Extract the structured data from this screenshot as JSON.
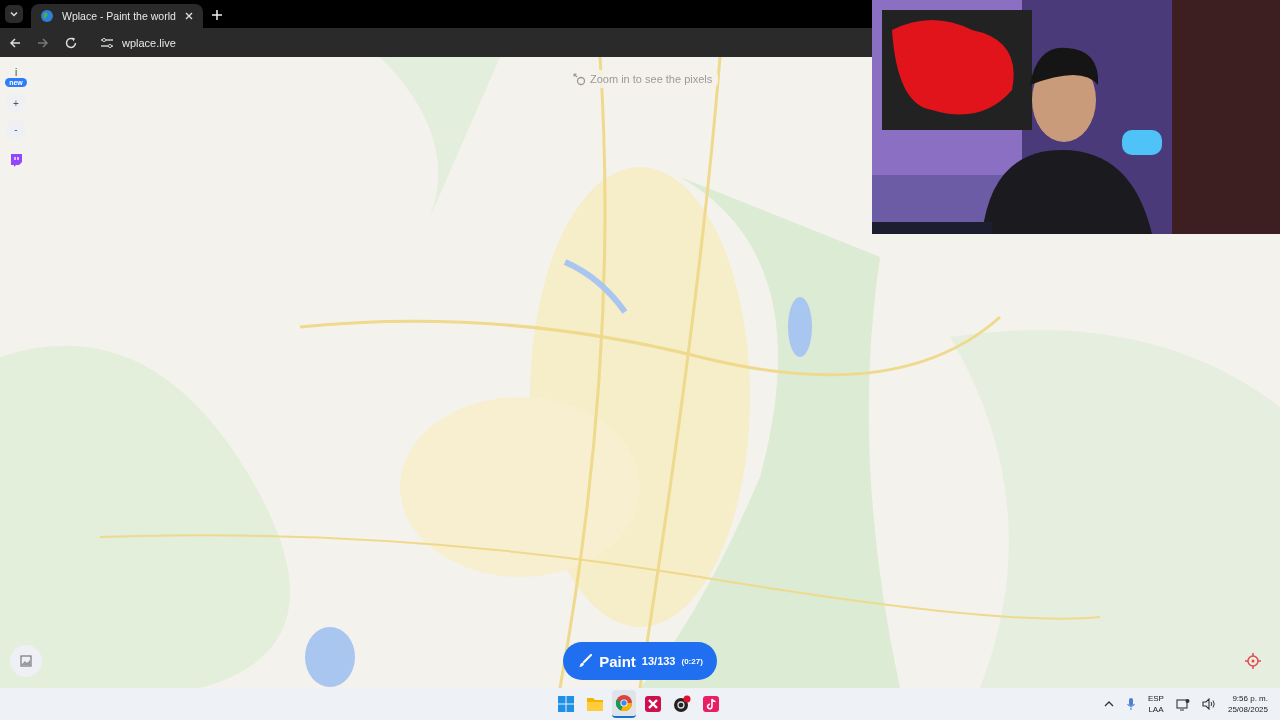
{
  "browser": {
    "tab_title": "Wplace - Paint the world",
    "url": "wplace.live"
  },
  "toolbar": {
    "info": "i",
    "badge": "new",
    "zoom_in": "+",
    "zoom_out": "-"
  },
  "hint": "Zoom in to see the pixels",
  "paint_button": {
    "label": "Paint",
    "count": "13/133",
    "timer": "(0:27)"
  },
  "taskbar": {
    "apps": [
      {
        "kind": "start",
        "selected": false
      },
      {
        "kind": "files",
        "selected": false
      },
      {
        "kind": "chrome",
        "selected": true
      },
      {
        "kind": "x-app",
        "selected": false
      },
      {
        "kind": "recorder",
        "selected": false
      },
      {
        "kind": "tiktok",
        "selected": false
      }
    ],
    "language": "ESP",
    "layout": "LAA",
    "time": "9:56 p. m.",
    "date": "25/08/2025"
  }
}
